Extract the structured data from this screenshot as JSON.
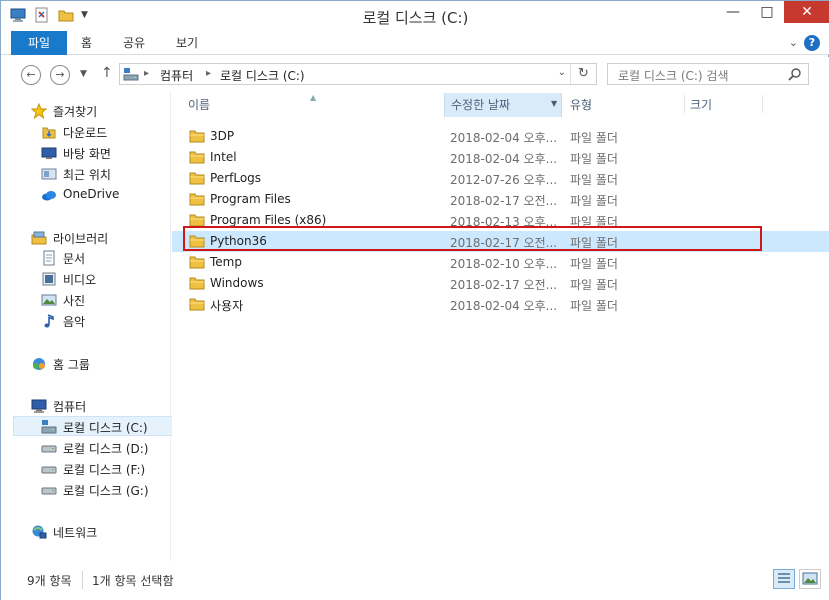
{
  "window": {
    "title": "로컬 디스크 (C:)"
  },
  "ribbon": {
    "tabs": [
      "파일",
      "홈",
      "공유",
      "보기"
    ]
  },
  "nav": {
    "breadcrumb": [
      "컴퓨터",
      "로컬 디스크 (C:)"
    ],
    "search_placeholder": "로컬 디스크 (C:) 검색"
  },
  "sidebar": {
    "favorites": {
      "label": "즐겨찾기",
      "items": [
        "다운로드",
        "바탕 화면",
        "최근 위치",
        "OneDrive"
      ]
    },
    "libraries": {
      "label": "라이브러리",
      "items": [
        "문서",
        "비디오",
        "사진",
        "음악"
      ]
    },
    "homegroup": {
      "label": "홈 그룹"
    },
    "computer": {
      "label": "컴퓨터",
      "items": [
        "로컬 디스크 (C:)",
        "로컬 디스크 (D:)",
        "로컬 디스크 (F:)",
        "로컬 디스크 (G:)"
      ]
    },
    "network": {
      "label": "네트워크"
    }
  },
  "columns": {
    "name": "이름",
    "date": "수정한 날짜",
    "type": "유형",
    "size": "크기"
  },
  "files": [
    {
      "name": "3DP",
      "date": "2018-02-04 오후...",
      "type": "파일 폴더"
    },
    {
      "name": "Intel",
      "date": "2018-02-04 오후...",
      "type": "파일 폴더"
    },
    {
      "name": "PerfLogs",
      "date": "2012-07-26 오후...",
      "type": "파일 폴더"
    },
    {
      "name": "Program Files",
      "date": "2018-02-17 오전...",
      "type": "파일 폴더"
    },
    {
      "name": "Program Files (x86)",
      "date": "2018-02-13 오후...",
      "type": "파일 폴더"
    },
    {
      "name": "Python36",
      "date": "2018-02-17 오전...",
      "type": "파일 폴더"
    },
    {
      "name": "Temp",
      "date": "2018-02-10 오후...",
      "type": "파일 폴더"
    },
    {
      "name": "Windows",
      "date": "2018-02-17 오전...",
      "type": "파일 폴더"
    },
    {
      "name": "사용자",
      "date": "2018-02-04 오후...",
      "type": "파일 폴더"
    }
  ],
  "status": {
    "count": "9개 항목",
    "selected": "1개 항목 선택함"
  },
  "colors": {
    "accent": "#1979ca",
    "selection": "#cce8ff",
    "highlight_border": "#d01818",
    "folder": "#e8b830"
  }
}
